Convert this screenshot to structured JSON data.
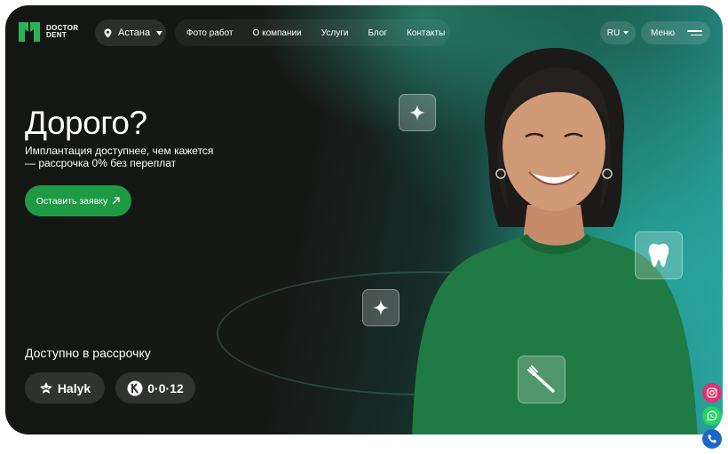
{
  "brand": {
    "line1": "DOCTOR",
    "line2": "DENT",
    "color": "#2bb35a"
  },
  "header": {
    "city": "Астана",
    "nav": [
      "Фото работ",
      "О компании",
      "Услуги",
      "Блог",
      "Контакты"
    ],
    "language": "RU",
    "menu_label": "Меню"
  },
  "hero": {
    "title": "Дорого?",
    "subtitle_line1": "Имплантация доступнее, чем кажется",
    "subtitle_line2": "— рассрочка 0% без переплат",
    "cta_label": "Оставить заявку",
    "cta_icon": "arrow-up-right-icon",
    "installment_label": "Доступно в рассрочку",
    "banks": [
      {
        "name": "Halyk",
        "icon": "halyk-logo-icon"
      },
      {
        "name": "0·0·12",
        "icon": "kaspi-logo-icon"
      }
    ]
  },
  "tiles": [
    "sparkle-icon",
    "tooth-icon",
    "sparkle-icon",
    "toothbrush-icon"
  ],
  "side_buttons": [
    {
      "icon": "instagram-icon",
      "color": "#e1306c"
    },
    {
      "icon": "whatsapp-icon",
      "color": "#25d366"
    },
    {
      "icon": "phone-icon",
      "color": "#1a66c9"
    }
  ],
  "colors": {
    "accent": "#1f9a44",
    "background": "#161816"
  }
}
